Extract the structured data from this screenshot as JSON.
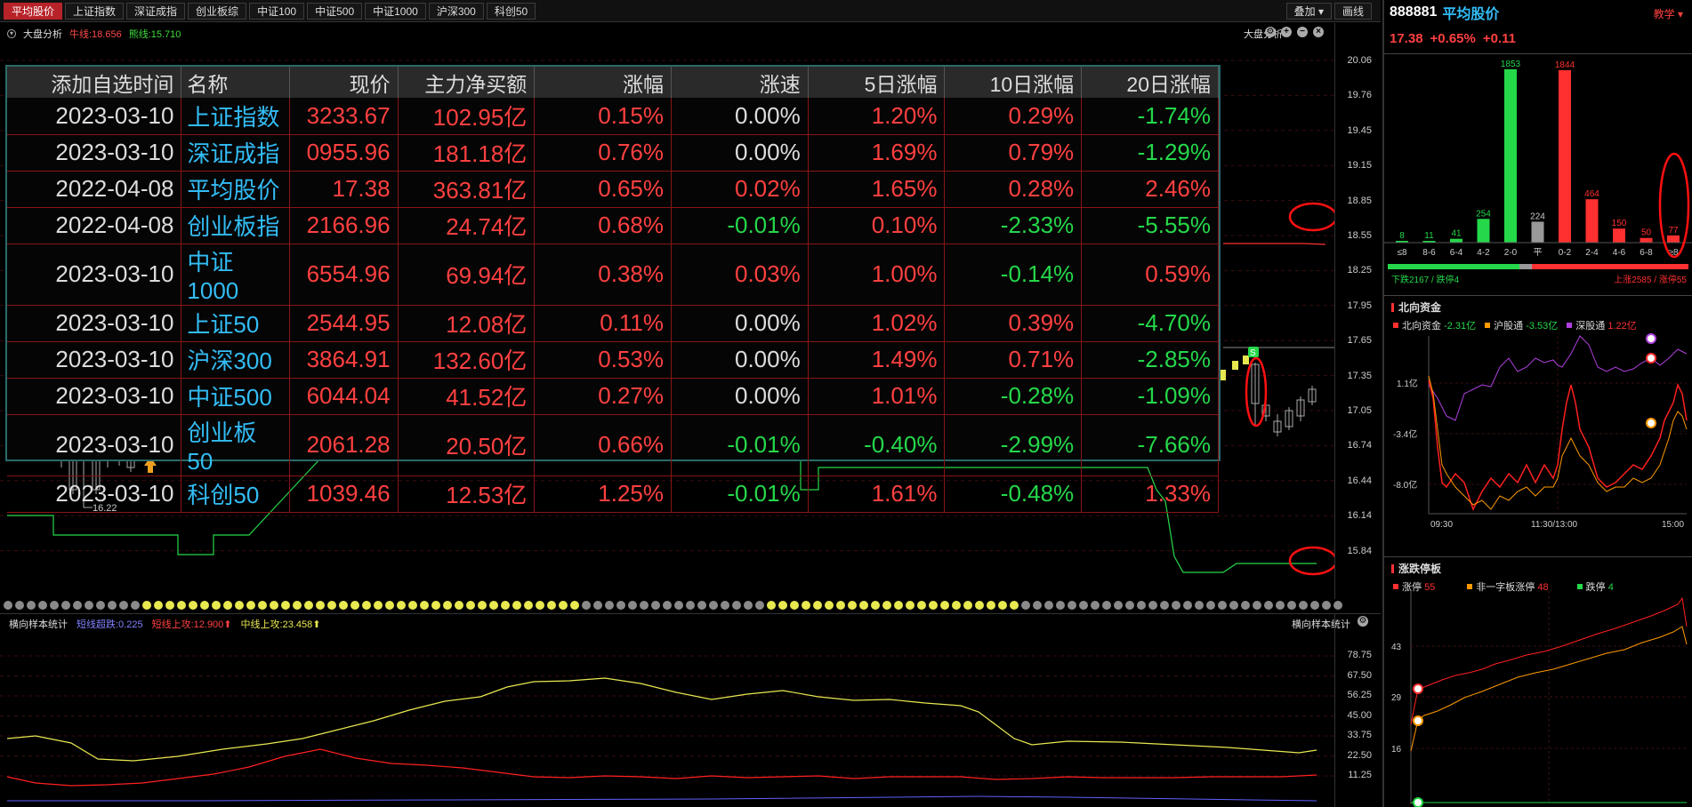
{
  "tabs": [
    "平均股价",
    "上证指数",
    "深证成指",
    "创业板综",
    "中证100",
    "中证500",
    "中证1000",
    "沪深300",
    "科创50"
  ],
  "toolbar": {
    "overlay": "叠加",
    "draw": "画线"
  },
  "main": {
    "info_label": "大盘分析",
    "cow_line": "牛线:18.656",
    "bear_line": "熊线:15.710",
    "dapan_label": "大盘分析",
    "y_ticks": [
      "20.06",
      "19.76",
      "19.45",
      "19.15",
      "18.85",
      "18.55",
      "18.25",
      "17.95",
      "17.65",
      "17.35",
      "17.05",
      "16.74",
      "16.44",
      "16.14",
      "15.84"
    ],
    "low_price": "16.22",
    "signal_s": "S"
  },
  "table": {
    "headers": [
      "添加自选时间",
      "名称",
      "现价",
      "主力净买额",
      "涨幅",
      "涨速",
      "5日涨幅",
      "10日涨幅",
      "20日涨幅"
    ],
    "rows": [
      [
        "2023-03-10",
        "上证指数",
        "3233.67",
        "102.95亿",
        "0.15%",
        "0.00%",
        "1.20%",
        "0.29%",
        "-1.74%"
      ],
      [
        "2023-03-10",
        "深证成指",
        "0955.96",
        "181.18亿",
        "0.76%",
        "0.00%",
        "1.69%",
        "0.79%",
        "-1.29%"
      ],
      [
        "2022-04-08",
        "平均股价",
        "17.38",
        "363.81亿",
        "0.65%",
        "0.02%",
        "1.65%",
        "0.28%",
        "2.46%"
      ],
      [
        "2022-04-08",
        "创业板指",
        "2166.96",
        "24.74亿",
        "0.68%",
        "-0.01%",
        "0.10%",
        "-2.33%",
        "-5.55%"
      ],
      [
        "2023-03-10",
        "中证1000",
        "6554.96",
        "69.94亿",
        "0.38%",
        "0.03%",
        "1.00%",
        "-0.14%",
        "0.59%"
      ],
      [
        "2023-03-10",
        "上证50",
        "2544.95",
        "12.08亿",
        "0.11%",
        "0.00%",
        "1.02%",
        "0.39%",
        "-4.70%"
      ],
      [
        "2023-03-10",
        "沪深300",
        "3864.91",
        "132.60亿",
        "0.53%",
        "0.00%",
        "1.49%",
        "0.71%",
        "-2.85%"
      ],
      [
        "2023-03-10",
        "中证500",
        "6044.04",
        "41.52亿",
        "0.27%",
        "0.00%",
        "1.01%",
        "-0.28%",
        "-1.09%"
      ],
      [
        "2023-03-10",
        "创业板50",
        "2061.28",
        "20.50亿",
        "0.66%",
        "-0.01%",
        "-0.40%",
        "-2.99%",
        "-7.66%"
      ],
      [
        "2023-03-10",
        "科创50",
        "1039.46",
        "12.53亿",
        "1.25%",
        "-0.01%",
        "1.61%",
        "-0.48%",
        "1.33%"
      ]
    ]
  },
  "lower": {
    "title": "横向样本统计",
    "short_fall": "短线超跌:0.225",
    "short_up": "短线上攻:12.900",
    "mid_up": "中线上攻:23.458",
    "right_title": "横向样本统计",
    "y_ticks": [
      "78.75",
      "67.50",
      "56.25",
      "45.00",
      "33.75",
      "22.50",
      "11.25"
    ]
  },
  "right": {
    "code": "888881",
    "name": "平均股价",
    "teach": "教学",
    "price": "17.38",
    "change_pct": "+0.65%",
    "change": "+0.11",
    "dist_values": [
      8,
      11,
      41,
      254,
      1853,
      224,
      1844,
      464,
      150,
      50,
      77
    ],
    "dist_labels": [
      "≤8",
      "8-6",
      "6-4",
      "4-2",
      "2-0",
      "平",
      "0-2",
      "2-4",
      "4-6",
      "6-8",
      "≥8"
    ],
    "down_text": "下跌2167 / 跌停4",
    "up_text": "上涨2585 / 涨停55",
    "north": {
      "title": "北向资金",
      "total_label": "北向资金",
      "total_value": "-2.31亿",
      "sh_label": "沪股通",
      "sh_value": "-3.53亿",
      "sz_label": "深股通",
      "sz_value": "1.22亿",
      "y_ticks": [
        "1.1亿",
        "-3.4亿",
        "-8.0亿"
      ],
      "x_ticks": [
        "09:30",
        "11:30/13:00",
        "15:00"
      ]
    },
    "limit": {
      "title": "涨跌停板",
      "up_label": "涨停",
      "up_value": "55",
      "nonone_label": "非一字板涨停",
      "nonone_value": "48",
      "down_label": "跌停",
      "down_value": "4",
      "y_ticks": [
        "43",
        "29",
        "16"
      ],
      "x_ticks": [
        "09:30",
        "11:30/13:00",
        "15:00"
      ]
    }
  },
  "colors": {
    "red": "#ff3030",
    "green": "#25d84a",
    "cyan": "#33bdf5",
    "yellow": "#e8e850",
    "purple": "#b040e0",
    "orange": "#ff9900"
  }
}
